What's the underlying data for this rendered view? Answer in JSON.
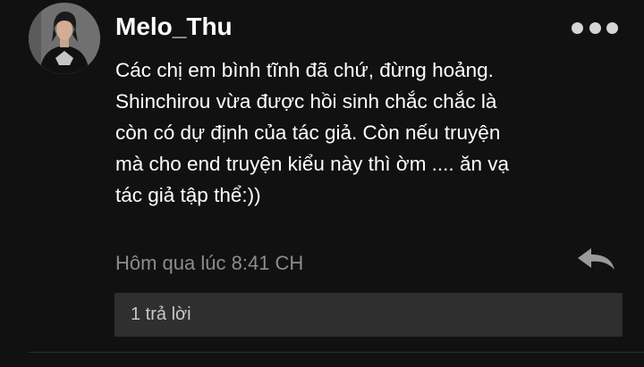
{
  "comment": {
    "author": "Melo_Thu",
    "body_lines": [
      "Các chị em bình tĩnh đã chứ, đừng hoảng.",
      "Shinchirou vừa được hồi sinh chắc chắc là",
      "còn có dự định của tác giả. Còn nếu truyện",
      "mà cho end truyện kiểu này thì ờm .... ăn vạ",
      "tác giả tập thể:))"
    ],
    "timestamp": "Hôm qua lúc 8:41 CH",
    "replies_label": "1 trả lời",
    "icons": {
      "more": "more-options-icon",
      "reply": "reply-arrow-icon"
    }
  },
  "colors": {
    "background": "#111111",
    "text": "#ffffff",
    "muted": "#8c8c8c",
    "reply_box": "#2f2f2f"
  }
}
